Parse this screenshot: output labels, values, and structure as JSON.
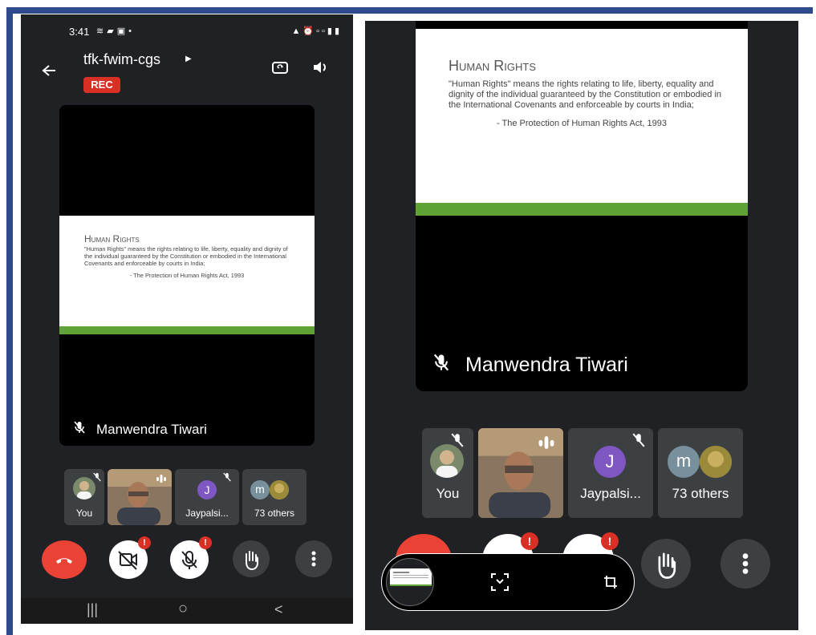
{
  "left_phone": {
    "status_bar": {
      "time": "3:41",
      "left_icons": [
        "weather-icon",
        "message-icon",
        "image-icon",
        "dot-icon"
      ],
      "right_icons": [
        "bag-icon",
        "alarm-icon",
        "volte-icon",
        "4g-icon",
        "signal-icon",
        "battery-icon"
      ]
    },
    "meeting_code": "tfk-fwim-cgs",
    "rec_label": "REC",
    "slide": {
      "title": "Human Rights",
      "quote": "\"Human Rights\" means the rights relating to life, liberty, equality and dignity of the individual guaranteed by the Constitution or embodied in the International Covenants and enforceable by courts in India;",
      "attribution": "- The Protection of Human Rights Act, 1993"
    },
    "speaker_name": "Manwendra Tiwari",
    "participants": [
      {
        "label": "You"
      },
      {
        "label": ""
      },
      {
        "label": "Jaypalsi...",
        "initial": "J"
      },
      {
        "label": "73 others",
        "initial": "m"
      }
    ],
    "badges": {
      "camera": "!",
      "mic": "!"
    },
    "nav": {
      "recents": "|||",
      "home": "○",
      "back": "<"
    }
  },
  "right_phone": {
    "slide": {
      "title": "Human Rights",
      "quote": "\"Human Rights\" means the rights relating to life, liberty, equality and dignity of the individual guaranteed by the Constitution or embodied in the International Covenants and enforceable by courts in India;",
      "attribution": "- The Protection of Human Rights Act, 1993"
    },
    "speaker_name": "Manwendra Tiwari",
    "participants": [
      {
        "label": "You"
      },
      {
        "label": ""
      },
      {
        "label": "Jaypalsi...",
        "initial": "J"
      },
      {
        "label": "73 others",
        "initial": "m"
      }
    ],
    "badges": {
      "camera": "!",
      "mic": "!"
    }
  },
  "colors": {
    "background": "#202124",
    "tile": "#3c4043",
    "end_call": "#ea4335",
    "rec": "#d93025",
    "avatar_j": "#7e57c2",
    "avatar_m": "#78909c",
    "slide_bar": "#5fa336",
    "frame": "#2f4a8a"
  }
}
